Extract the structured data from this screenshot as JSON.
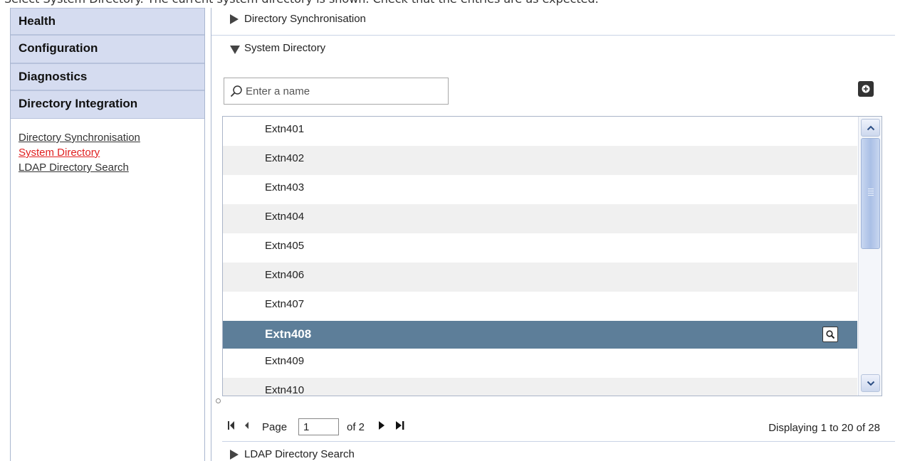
{
  "caption": "Select System Directory. The current system directory is shown. Check that the entries are as expected.",
  "nav": {
    "headers": [
      "Health",
      "Configuration",
      "Diagnostics",
      "Directory Integration"
    ],
    "links": [
      {
        "label": "Directory Synchronisation",
        "active": false
      },
      {
        "label": "System Directory",
        "active": true
      },
      {
        "label": "LDAP Directory Search",
        "active": false
      }
    ]
  },
  "sections": {
    "sync": "Directory Synchronisation",
    "system": "System Directory",
    "ldap": "LDAP Directory Search"
  },
  "search": {
    "placeholder": "Enter a name",
    "value": ""
  },
  "list": {
    "items": [
      "Extn401",
      "Extn402",
      "Extn403",
      "Extn404",
      "Extn405",
      "Extn406",
      "Extn407",
      "Extn408",
      "Extn409",
      "Extn410"
    ],
    "selected_index": 7
  },
  "pager": {
    "page_label": "Page",
    "page_value": "1",
    "of_label": "of 2",
    "displaying": "Displaying 1 to 20 of 28"
  },
  "colors": {
    "nav_header_bg": "#d5dcf0",
    "selected_row_bg": "#5d7e99",
    "active_link": "#e02020"
  },
  "icons": {
    "search": "search-icon",
    "add": "add-icon",
    "view": "magnifier-icon",
    "scroll_up": "chevron-up-icon",
    "scroll_down": "chevron-down-icon",
    "first": "first-page-icon",
    "prev": "prev-page-icon",
    "next": "next-page-icon",
    "last": "last-page-icon"
  }
}
